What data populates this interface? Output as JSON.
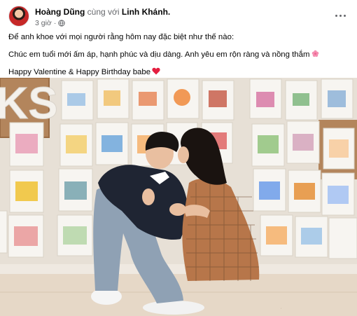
{
  "post": {
    "author": "Hoàng Dũng",
    "with_text": "cùng với",
    "tagged": "Linh Khánh.",
    "time": "3 giờ",
    "audience_icon": "globe-icon",
    "more_icon": "more-options-icon"
  },
  "caption": {
    "line1": "Để anh khoe với mọi người rằng hôm nay đặc biệt như thế nào:",
    "line2": "Chúc em tuổi mới ấm áp, hạnh phúc và dịu dàng. Anh yêu em rộn ràng và nồng thắm",
    "line2_emoji": "cherry-blossom-icon",
    "line3": "Happy Valentine & Happy Birthday babe",
    "line3_emoji": "red-heart-icon"
  },
  "photo": {
    "letters": "KS"
  },
  "colors": {
    "text_primary": "#050505",
    "text_secondary": "#65676b",
    "heart": "#e41e3f",
    "flower": "#f48fb1"
  }
}
